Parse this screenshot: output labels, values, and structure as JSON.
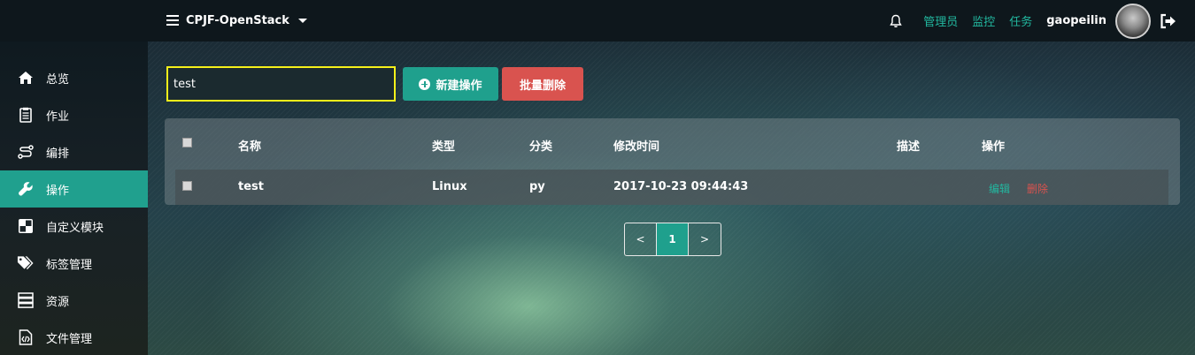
{
  "header": {
    "project_name": "CPJF-OpenStack",
    "links": {
      "admin": "管理员",
      "monitor": "监控",
      "tasks": "任务"
    },
    "username": "gaopeilin"
  },
  "sidebar": {
    "items": [
      {
        "label": "总览",
        "icon": "home-icon"
      },
      {
        "label": "作业",
        "icon": "clipboard-icon"
      },
      {
        "label": "编排",
        "icon": "route-icon"
      },
      {
        "label": "操作",
        "icon": "wrench-icon",
        "active": true
      },
      {
        "label": "自定义模块",
        "icon": "module-icon"
      },
      {
        "label": "标签管理",
        "icon": "tags-icon"
      },
      {
        "label": "资源",
        "icon": "server-icon"
      },
      {
        "label": "文件管理",
        "icon": "file-code-icon"
      }
    ]
  },
  "toolbar": {
    "search_value": "test",
    "new_label": "新建操作",
    "bulk_delete_label": "批量删除"
  },
  "table": {
    "columns": [
      "名称",
      "类型",
      "分类",
      "修改时间",
      "描述",
      "操作"
    ],
    "rows": [
      {
        "name": "test",
        "type": "Linux",
        "category": "py",
        "modified": "2017-10-23 09:44:43",
        "description": "",
        "actions": {
          "edit": "编辑",
          "delete": "删除"
        }
      }
    ]
  },
  "pagination": {
    "prev": "<",
    "current": "1",
    "next": ">"
  },
  "colors": {
    "accent": "#1fa08d",
    "danger": "#d9534f",
    "focus_border": "#f5f01a"
  }
}
